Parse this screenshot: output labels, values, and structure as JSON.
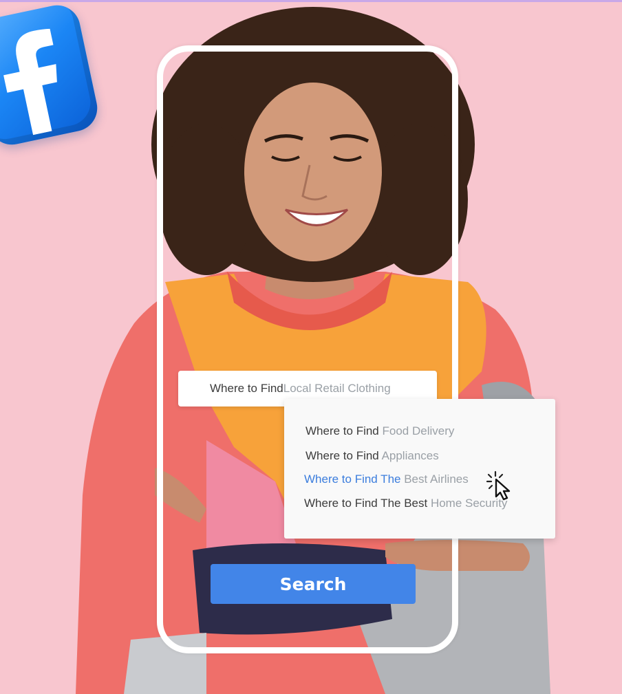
{
  "search": {
    "query_prefix": "Where to Find ",
    "query_value": "Local Retail Clothing"
  },
  "suggestions": [
    {
      "prefix": "Where to Find ",
      "term": "Food Delivery",
      "highlighted": false
    },
    {
      "prefix": "Where to Find ",
      "term": "Appliances",
      "highlighted": false
    },
    {
      "prefix": "Where to Find The ",
      "term": "Best Airlines",
      "highlighted": true
    },
    {
      "prefix": "Where to Find The Best ",
      "term": "Home Security",
      "highlighted": false
    }
  ],
  "search_button_label": "Search",
  "icons": {
    "brand": "facebook-logo-icon",
    "pointer": "click-cursor-icon"
  },
  "colors": {
    "background": "#f8c6cf",
    "facebook_blue": "#1b86f5",
    "button_blue": "#4285e8",
    "highlight_blue": "#3b7ddd",
    "suggestion_gray": "#9aa0a6"
  }
}
